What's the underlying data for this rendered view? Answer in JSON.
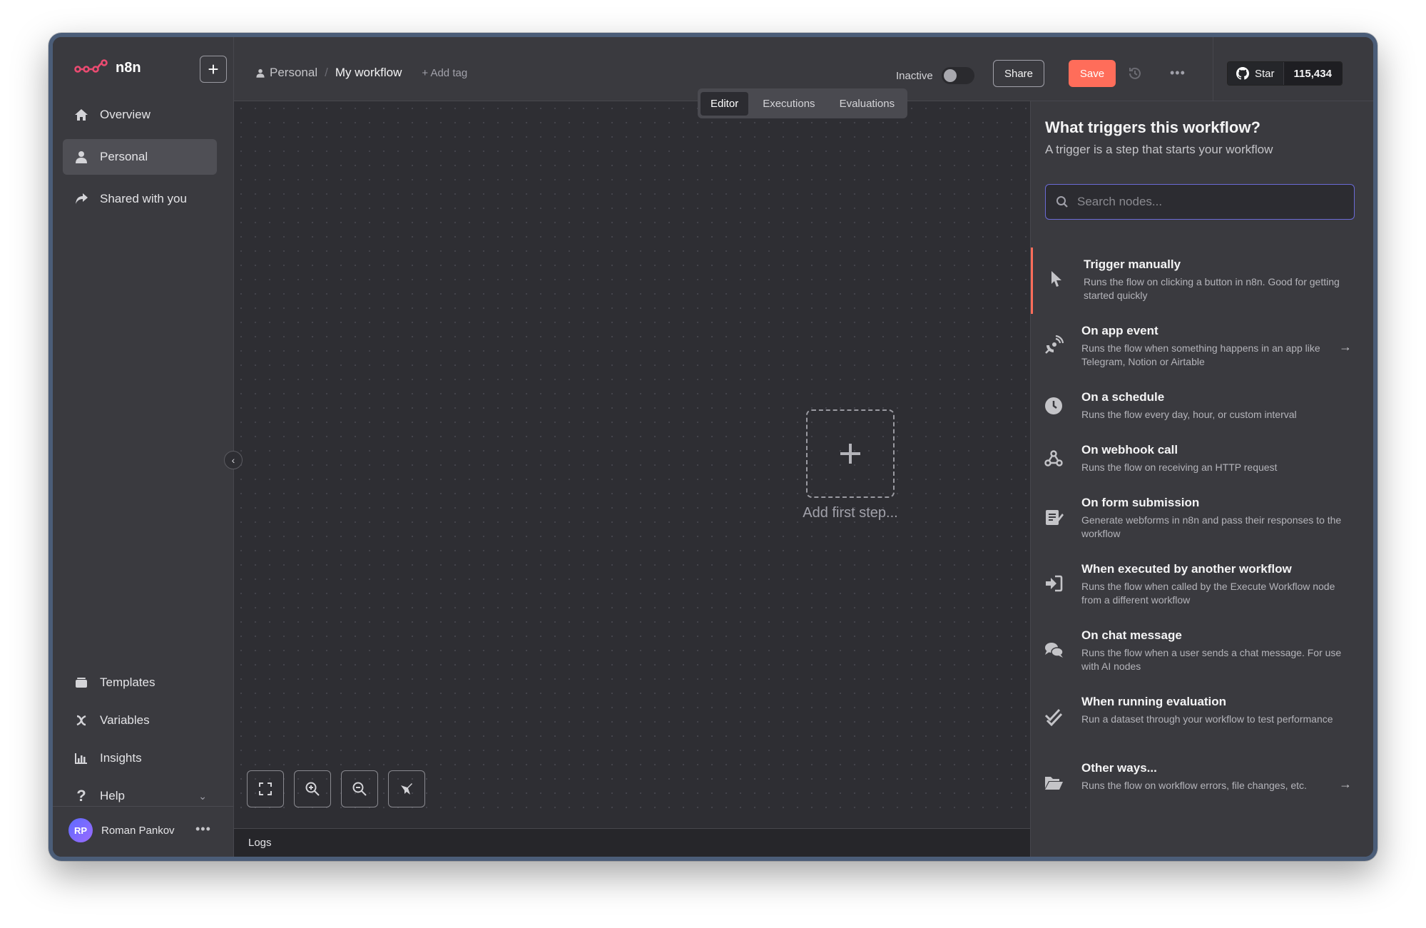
{
  "app": {
    "name": "n8n"
  },
  "sidebar": {
    "new_label": "+",
    "items": [
      {
        "label": "Overview",
        "icon": "home-icon"
      },
      {
        "label": "Personal",
        "icon": "user-icon",
        "active": true
      },
      {
        "label": "Shared with you",
        "icon": "share-icon"
      }
    ],
    "bottom_items": [
      {
        "label": "Templates",
        "icon": "templates-icon"
      },
      {
        "label": "Variables",
        "icon": "variables-icon"
      },
      {
        "label": "Insights",
        "icon": "insights-icon"
      },
      {
        "label": "Help",
        "icon": "help-icon"
      }
    ],
    "user": {
      "initials": "RP",
      "name": "Roman Pankov"
    }
  },
  "header": {
    "breadcrumb_project": "Personal",
    "breadcrumb_sep": "/",
    "workflow_name": "My workflow",
    "add_tag": "+ Add tag",
    "status_label": "Inactive",
    "share_label": "Share",
    "save_label": "Save",
    "github_star_label": "Star",
    "github_star_count": "115,434"
  },
  "tabs": [
    {
      "label": "Editor",
      "active": true
    },
    {
      "label": "Executions"
    },
    {
      "label": "Evaluations"
    }
  ],
  "canvas": {
    "add_first_step": "Add first step..."
  },
  "logs_label": "Logs",
  "panel": {
    "title": "What triggers this workflow?",
    "subtitle": "A trigger is a step that starts your workflow",
    "search_placeholder": "Search nodes...",
    "triggers": [
      {
        "name": "Trigger manually",
        "desc": "Runs the flow on clicking a button in n8n. Good for getting started quickly",
        "icon": "cursor-icon"
      },
      {
        "name": "On app event",
        "desc": "Runs the flow when something happens in an app like Telegram, Notion or Airtable",
        "icon": "satellite-icon"
      },
      {
        "name": "On a schedule",
        "desc": "Runs the flow every day, hour, or custom interval",
        "icon": "clock-icon"
      },
      {
        "name": "On webhook call",
        "desc": "Runs the flow on receiving an HTTP request",
        "icon": "webhook-icon"
      },
      {
        "name": "On form submission",
        "desc": "Generate webforms in n8n and pass their responses to the workflow",
        "icon": "form-icon"
      },
      {
        "name": "When executed by another workflow",
        "desc": "Runs the flow when called by the Execute Workflow node from a different workflow",
        "icon": "sign-in-icon"
      },
      {
        "name": "On chat message",
        "desc": "Runs the flow when a user sends a chat message. For use with AI nodes",
        "icon": "chat-icon"
      },
      {
        "name": "When running evaluation",
        "desc": "Run a dataset through your workflow to test performance",
        "icon": "check-double-icon"
      },
      {
        "name": "Other ways...",
        "desc": "Runs the flow on workflow errors, file changes, etc.",
        "icon": "folder-open-icon"
      }
    ]
  },
  "colors": {
    "accent": "#ff6d5a",
    "focus": "#6b6bd6"
  }
}
